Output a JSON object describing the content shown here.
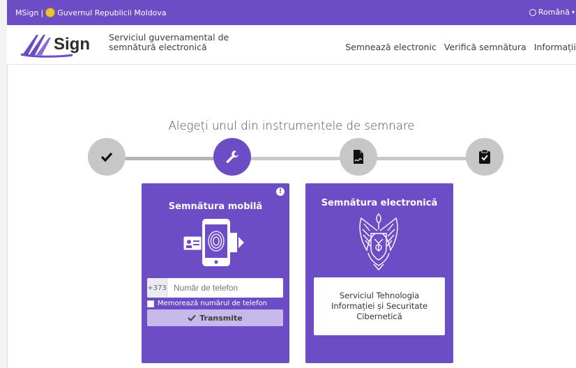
{
  "topbar": {
    "brand": "MSign",
    "separator": "|",
    "government": "Guvernul Republicii Moldova",
    "language": "Română",
    "language_caret": "▾"
  },
  "header": {
    "logo_text": "Sign",
    "tagline_line1": "Serviciul guvernamental de",
    "tagline_line2": "semnătură electronică",
    "nav": {
      "sign": "Semnează electronic",
      "verify": "Verifică semnătura",
      "info": "Informații"
    }
  },
  "main": {
    "title": "Alegeți unul din instrumentele de semnare",
    "steps": [
      {
        "icon": "check-icon"
      },
      {
        "icon": "wrench-icon"
      },
      {
        "icon": "document-signature-icon"
      },
      {
        "icon": "clipboard-check-icon"
      }
    ],
    "mobile_card": {
      "title": "Semnătura mobilă",
      "info_badge": "!",
      "prefix": "+373",
      "placeholder": "Număr de telefon",
      "remember_label": "Memorează numărul de telefon",
      "submit_label": "Transmite"
    },
    "electronic_card": {
      "title": "Semnătura electronică",
      "provider": "Serviciul Tehnologia Informației și Securitate Cibernetică"
    }
  },
  "colors": {
    "accent": "#6d4dc5",
    "step_inactive": "#c7c7c7",
    "submit_bg": "#c6b8ea"
  }
}
